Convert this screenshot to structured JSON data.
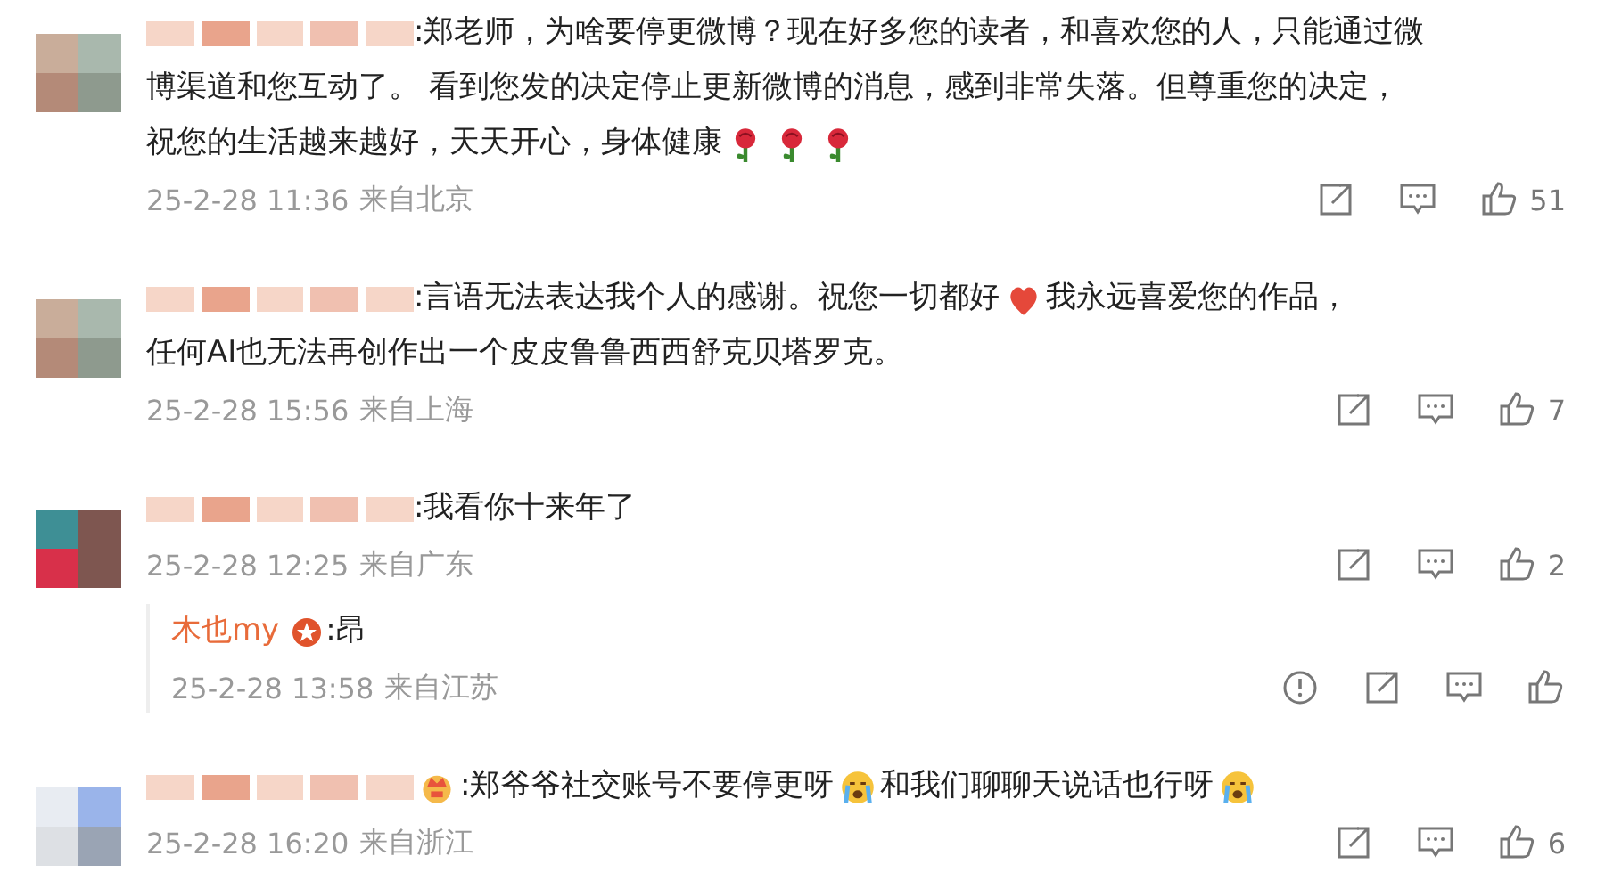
{
  "comments": [
    {
      "lines": [
        [
          {
            "kind": "text",
            "text": ":郑老师，为啥要停更微博？现在好多您的读者，和喜欢您的人，只能通过微"
          }
        ],
        [
          {
            "kind": "text",
            "text": "博渠道和您互动了。 看到您发的决定停止更新微博的消息，感到非常失落。但尊重您的决定，"
          }
        ],
        [
          {
            "kind": "text",
            "text": "祝您的生活越来越好，天天开心，身体健康"
          },
          {
            "kind": "rose"
          },
          {
            "kind": "rose"
          },
          {
            "kind": "rose"
          }
        ]
      ],
      "time": "25-2-28 11:36",
      "location": "来自北京",
      "actions": [
        {
          "kind": "share"
        },
        {
          "kind": "comment"
        },
        {
          "kind": "like",
          "count": "51"
        }
      ]
    },
    {
      "lines": [
        [
          {
            "kind": "text",
            "text": ":言语无法表达我个人的感谢。祝您一切都好"
          },
          {
            "kind": "heart"
          },
          {
            "kind": "text",
            "text": "我永远喜爱您的作品，"
          }
        ],
        [
          {
            "kind": "text",
            "text": "任何AI也无法再创作出一个皮皮鲁鲁西西舒克贝塔罗克。"
          }
        ]
      ],
      "time": "25-2-28 15:56",
      "location": "来自上海",
      "actions": [
        {
          "kind": "share"
        },
        {
          "kind": "comment"
        },
        {
          "kind": "like",
          "count": "7"
        }
      ]
    },
    {
      "lines": [
        [
          {
            "kind": "text",
            "text": ":我看你十来年了"
          }
        ]
      ],
      "time": "25-2-28 12:25",
      "location": "来自广东",
      "actions": [
        {
          "kind": "share"
        },
        {
          "kind": "comment"
        },
        {
          "kind": "like",
          "count": "2"
        }
      ],
      "replies": [
        {
          "author": "木也my",
          "parts": [
            {
              "kind": "text",
              "text": ":昂"
            }
          ],
          "time": "25-2-28 13:58",
          "location": "来自江苏",
          "actions": [
            {
              "kind": "report"
            },
            {
              "kind": "share"
            },
            {
              "kind": "comment"
            },
            {
              "kind": "like"
            }
          ]
        }
      ]
    },
    {
      "lines": [
        [
          {
            "kind": "crown"
          },
          {
            "kind": "text",
            "text": ":郑爷爷社交账号不要停更呀"
          },
          {
            "kind": "crying"
          },
          {
            "kind": "text",
            "text": "和我们聊聊天说话也行呀"
          },
          {
            "kind": "crying"
          }
        ]
      ],
      "time": "25-2-28 16:20",
      "location": "来自浙江",
      "actions": [
        {
          "kind": "share"
        },
        {
          "kind": "comment"
        },
        {
          "kind": "like",
          "count": "6"
        }
      ]
    }
  ]
}
